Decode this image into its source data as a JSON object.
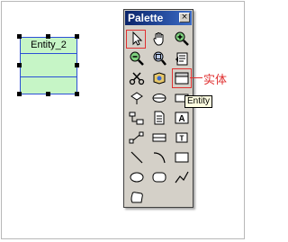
{
  "canvas": {
    "entity_name": "Entity_2"
  },
  "palette": {
    "title": "Palette",
    "close_glyph": "×",
    "tools": [
      {
        "icon": "pointer-icon"
      },
      {
        "icon": "grabber-hand-icon"
      },
      {
        "icon": "zoom-in-icon"
      },
      {
        "icon": "zoom-out-icon"
      },
      {
        "icon": "zoom-fit-icon"
      },
      {
        "icon": "open-package-icon"
      },
      {
        "icon": "delete-cut-icon"
      },
      {
        "icon": "package-icon"
      },
      {
        "icon": "entity-icon"
      },
      {
        "icon": "inheritance-icon"
      },
      {
        "icon": "view-icon"
      },
      {
        "icon": "procedure-icon"
      },
      {
        "icon": "file-icon"
      },
      {
        "icon": "text-icon"
      },
      {
        "icon": "reference-link-icon"
      },
      {
        "icon": "table-icon"
      },
      {
        "icon": "title-icon"
      },
      {
        "icon": "line-icon"
      },
      {
        "icon": "arc-icon"
      },
      {
        "icon": "rectangle-icon"
      },
      {
        "icon": "ellipse-icon"
      },
      {
        "icon": "rounded-rectangle-icon"
      },
      {
        "icon": "polyline-icon"
      },
      {
        "icon": "polygon-icon"
      }
    ]
  },
  "tooltip": "Entity",
  "annotation": "实体",
  "colors": {
    "annotation_red": "#e03030",
    "entity_fill": "#c6f5c6",
    "entity_border": "#2b4fd6",
    "titlebar_start": "#0a246a"
  }
}
